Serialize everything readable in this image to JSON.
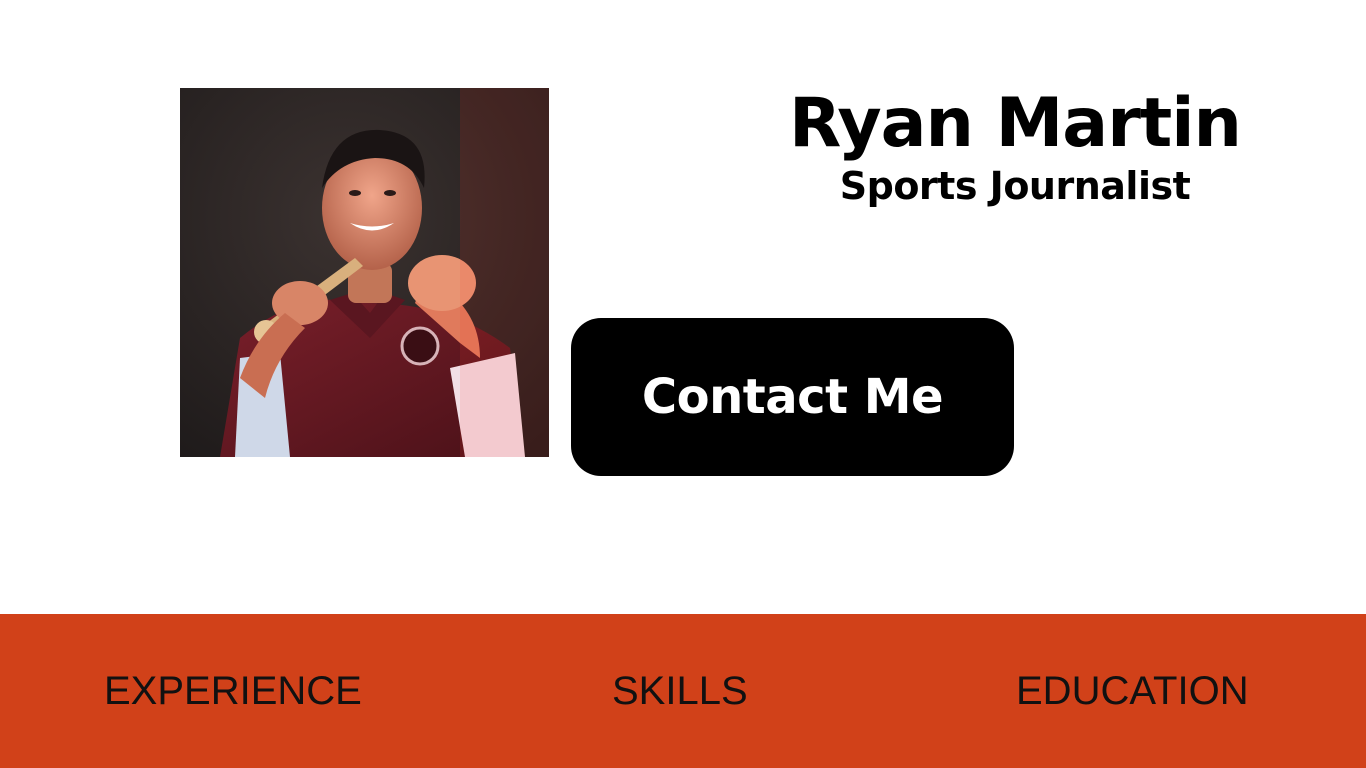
{
  "profile": {
    "name": "Ryan Martin",
    "title": "Sports Journalist",
    "photo_icon": "profile-photo"
  },
  "contact": {
    "label": "Contact Me"
  },
  "nav": {
    "items": [
      {
        "label": "EXPERIENCE"
      },
      {
        "label": "SKILLS"
      },
      {
        "label": "EDUCATION"
      }
    ]
  },
  "colors": {
    "background": "#ffffff",
    "accent_bar": "#d14119",
    "button": "#000000",
    "button_text": "#ffffff",
    "text": "#000000"
  }
}
